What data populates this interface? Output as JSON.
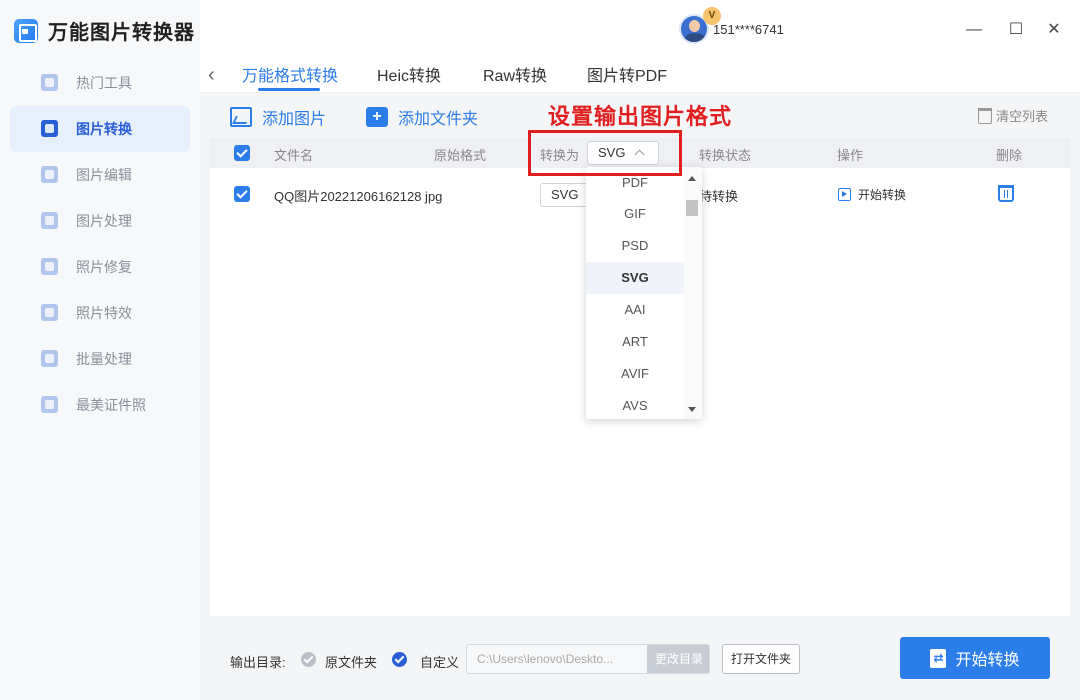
{
  "app": {
    "title": "万能图片转换器"
  },
  "user": {
    "vip_badge": "V",
    "name": "151****6741"
  },
  "window_controls": {
    "minimize": "—",
    "maximize": "☐",
    "close": "✕"
  },
  "sidebar": {
    "items": [
      {
        "label": "热门工具",
        "icon": "grid-icon",
        "active": false
      },
      {
        "label": "图片转换",
        "icon": "image-convert-icon",
        "active": true
      },
      {
        "label": "图片编辑",
        "icon": "image-edit-icon",
        "active": false
      },
      {
        "label": "图片处理",
        "icon": "image-process-icon",
        "active": false
      },
      {
        "label": "照片修复",
        "icon": "photo-repair-icon",
        "active": false
      },
      {
        "label": "照片特效",
        "icon": "photo-effect-icon",
        "active": false
      },
      {
        "label": "批量处理",
        "icon": "batch-icon",
        "active": false
      },
      {
        "label": "最美证件照",
        "icon": "id-photo-icon",
        "active": false
      }
    ]
  },
  "tabs": {
    "back": "‹",
    "items": [
      {
        "label": "万能格式转换",
        "active": true
      },
      {
        "label": "Heic转换",
        "active": false
      },
      {
        "label": "Raw转换",
        "active": false
      },
      {
        "label": "图片转PDF",
        "active": false
      }
    ]
  },
  "toolbar": {
    "add_image": "添加图片",
    "add_folder": "添加文件夹",
    "clear_list": "清空列表"
  },
  "annotation": {
    "text": "设置输出图片格式",
    "color": "#e02020"
  },
  "table": {
    "headers": {
      "filename": "文件名",
      "original_format": "原始格式",
      "convert_to": "转换为",
      "status": "转换状态",
      "action": "操作",
      "delete": "删除"
    },
    "global_format": "SVG",
    "rows": [
      {
        "filename": "QQ图片20221206162128 jpg",
        "format": "SVG",
        "status": "待转换",
        "action": "开始转换"
      }
    ]
  },
  "dropdown": {
    "options": [
      "PDF",
      "GIF",
      "PSD",
      "SVG",
      "AAI",
      "ART",
      "AVIF",
      "AVS"
    ],
    "selected": "SVG"
  },
  "footer": {
    "output_label": "输出目录:",
    "option_original": "原文件夹",
    "option_custom": "自定义",
    "path": "C:\\Users\\lenovo\\Deskto...",
    "change_dir": "更改目录",
    "open_folder": "打开文件夹",
    "start": "开始转换"
  },
  "colors": {
    "accent": "#2b7de9",
    "sidebar_active": "#2b5fd6",
    "annotation": "#e02020"
  }
}
